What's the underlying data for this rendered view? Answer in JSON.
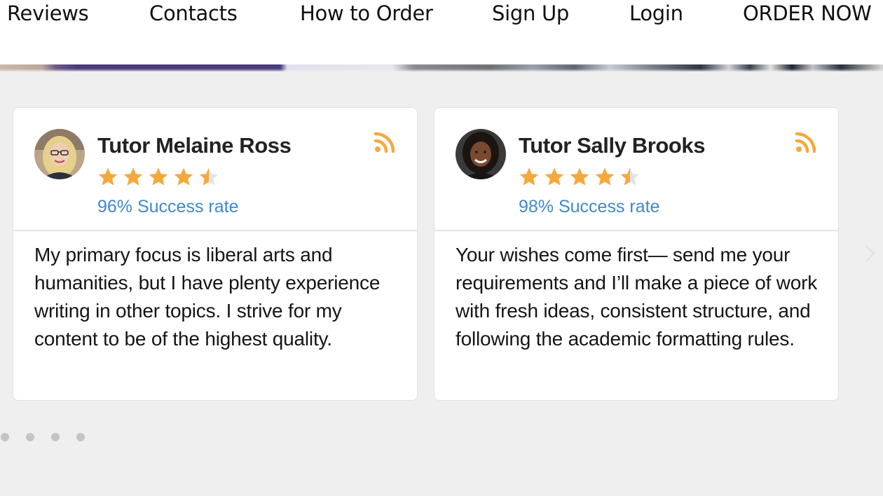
{
  "nav": {
    "items": [
      "Reviews",
      "Contacts",
      "How to Order",
      "Sign Up",
      "Login",
      "ORDER NOW"
    ]
  },
  "colors": {
    "star": "#f5a93d",
    "rss": "#f5a93d",
    "success_text": "#3f88d0",
    "page_bg": "#efefef"
  },
  "cards": [
    {
      "name": "Tutor Melaine Ross",
      "rating": 4.5,
      "success": "96% Success rate",
      "body": "My primary focus is liberal arts and humanities, but I have plenty experience writing in other topics. I strive for my content to be of the highest quality.",
      "avatar_icon": "avatar-blonde-glasses"
    },
    {
      "name": "Tutor Sally Brooks",
      "rating": 4.5,
      "success": "98% Success rate",
      "body": "Your wishes come first— send me your requirements and I’ll make a piece of work with fresh ideas, consistent structure, and following the academic formatting rules.",
      "avatar_icon": "avatar-dark-hair"
    }
  ],
  "carousel": {
    "dot_count": 4,
    "active_index": 0
  }
}
